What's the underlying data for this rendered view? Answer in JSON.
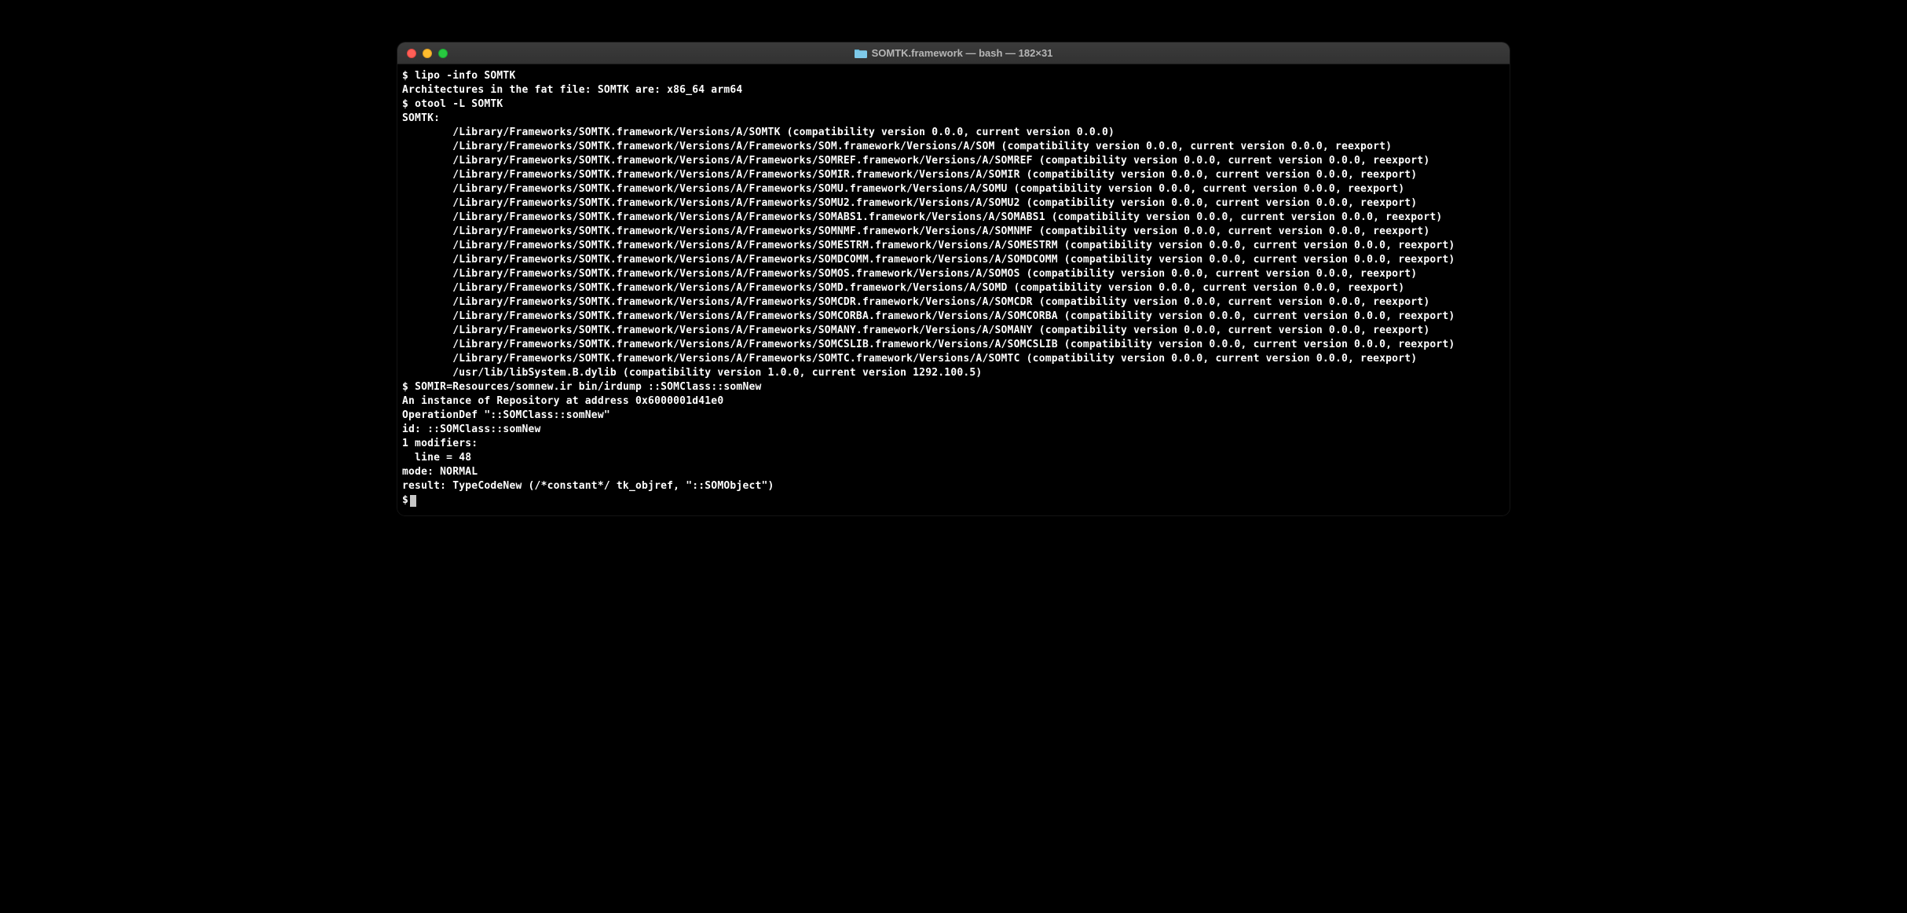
{
  "window": {
    "title": "SOMTK.framework — bash — 182×31",
    "folder_icon": "folder-icon"
  },
  "terminal": {
    "prompt": "$",
    "commands": {
      "lipo": "lipo -info SOMTK",
      "otool": "otool -L SOMTK",
      "somir": "SOMIR=Resources/somnew.ir bin/irdump ::SOMClass::somNew"
    },
    "lipo_output": "Architectures in the fat file: SOMTK are: x86_64 arm64",
    "otool_header": "SOMTK:",
    "otool_libs": [
      "/Library/Frameworks/SOMTK.framework/Versions/A/SOMTK (compatibility version 0.0.0, current version 0.0.0)",
      "/Library/Frameworks/SOMTK.framework/Versions/A/Frameworks/SOM.framework/Versions/A/SOM (compatibility version 0.0.0, current version 0.0.0, reexport)",
      "/Library/Frameworks/SOMTK.framework/Versions/A/Frameworks/SOMREF.framework/Versions/A/SOMREF (compatibility version 0.0.0, current version 0.0.0, reexport)",
      "/Library/Frameworks/SOMTK.framework/Versions/A/Frameworks/SOMIR.framework/Versions/A/SOMIR (compatibility version 0.0.0, current version 0.0.0, reexport)",
      "/Library/Frameworks/SOMTK.framework/Versions/A/Frameworks/SOMU.framework/Versions/A/SOMU (compatibility version 0.0.0, current version 0.0.0, reexport)",
      "/Library/Frameworks/SOMTK.framework/Versions/A/Frameworks/SOMU2.framework/Versions/A/SOMU2 (compatibility version 0.0.0, current version 0.0.0, reexport)",
      "/Library/Frameworks/SOMTK.framework/Versions/A/Frameworks/SOMABS1.framework/Versions/A/SOMABS1 (compatibility version 0.0.0, current version 0.0.0, reexport)",
      "/Library/Frameworks/SOMTK.framework/Versions/A/Frameworks/SOMNMF.framework/Versions/A/SOMNMF (compatibility version 0.0.0, current version 0.0.0, reexport)",
      "/Library/Frameworks/SOMTK.framework/Versions/A/Frameworks/SOMESTRM.framework/Versions/A/SOMESTRM (compatibility version 0.0.0, current version 0.0.0, reexport)",
      "/Library/Frameworks/SOMTK.framework/Versions/A/Frameworks/SOMDCOMM.framework/Versions/A/SOMDCOMM (compatibility version 0.0.0, current version 0.0.0, reexport)",
      "/Library/Frameworks/SOMTK.framework/Versions/A/Frameworks/SOMOS.framework/Versions/A/SOMOS (compatibility version 0.0.0, current version 0.0.0, reexport)",
      "/Library/Frameworks/SOMTK.framework/Versions/A/Frameworks/SOMD.framework/Versions/A/SOMD (compatibility version 0.0.0, current version 0.0.0, reexport)",
      "/Library/Frameworks/SOMTK.framework/Versions/A/Frameworks/SOMCDR.framework/Versions/A/SOMCDR (compatibility version 0.0.0, current version 0.0.0, reexport)",
      "/Library/Frameworks/SOMTK.framework/Versions/A/Frameworks/SOMCORBA.framework/Versions/A/SOMCORBA (compatibility version 0.0.0, current version 0.0.0, reexport)",
      "/Library/Frameworks/SOMTK.framework/Versions/A/Frameworks/SOMANY.framework/Versions/A/SOMANY (compatibility version 0.0.0, current version 0.0.0, reexport)",
      "/Library/Frameworks/SOMTK.framework/Versions/A/Frameworks/SOMCSLIB.framework/Versions/A/SOMCSLIB (compatibility version 0.0.0, current version 0.0.0, reexport)",
      "/Library/Frameworks/SOMTK.framework/Versions/A/Frameworks/SOMTC.framework/Versions/A/SOMTC (compatibility version 0.0.0, current version 0.0.0, reexport)",
      "/usr/lib/libSystem.B.dylib (compatibility version 1.0.0, current version 1292.100.5)"
    ],
    "irdump_output": [
      "An instance of Repository at address 0x6000001d41e0",
      "OperationDef \"::SOMClass::somNew\"",
      "id: ::SOMClass::somNew",
      "1 modifiers:",
      "  line = 48",
      "mode: NORMAL",
      "result: TypeCodeNew (/*constant*/ tk_objref, \"::SOMObject\")"
    ]
  }
}
